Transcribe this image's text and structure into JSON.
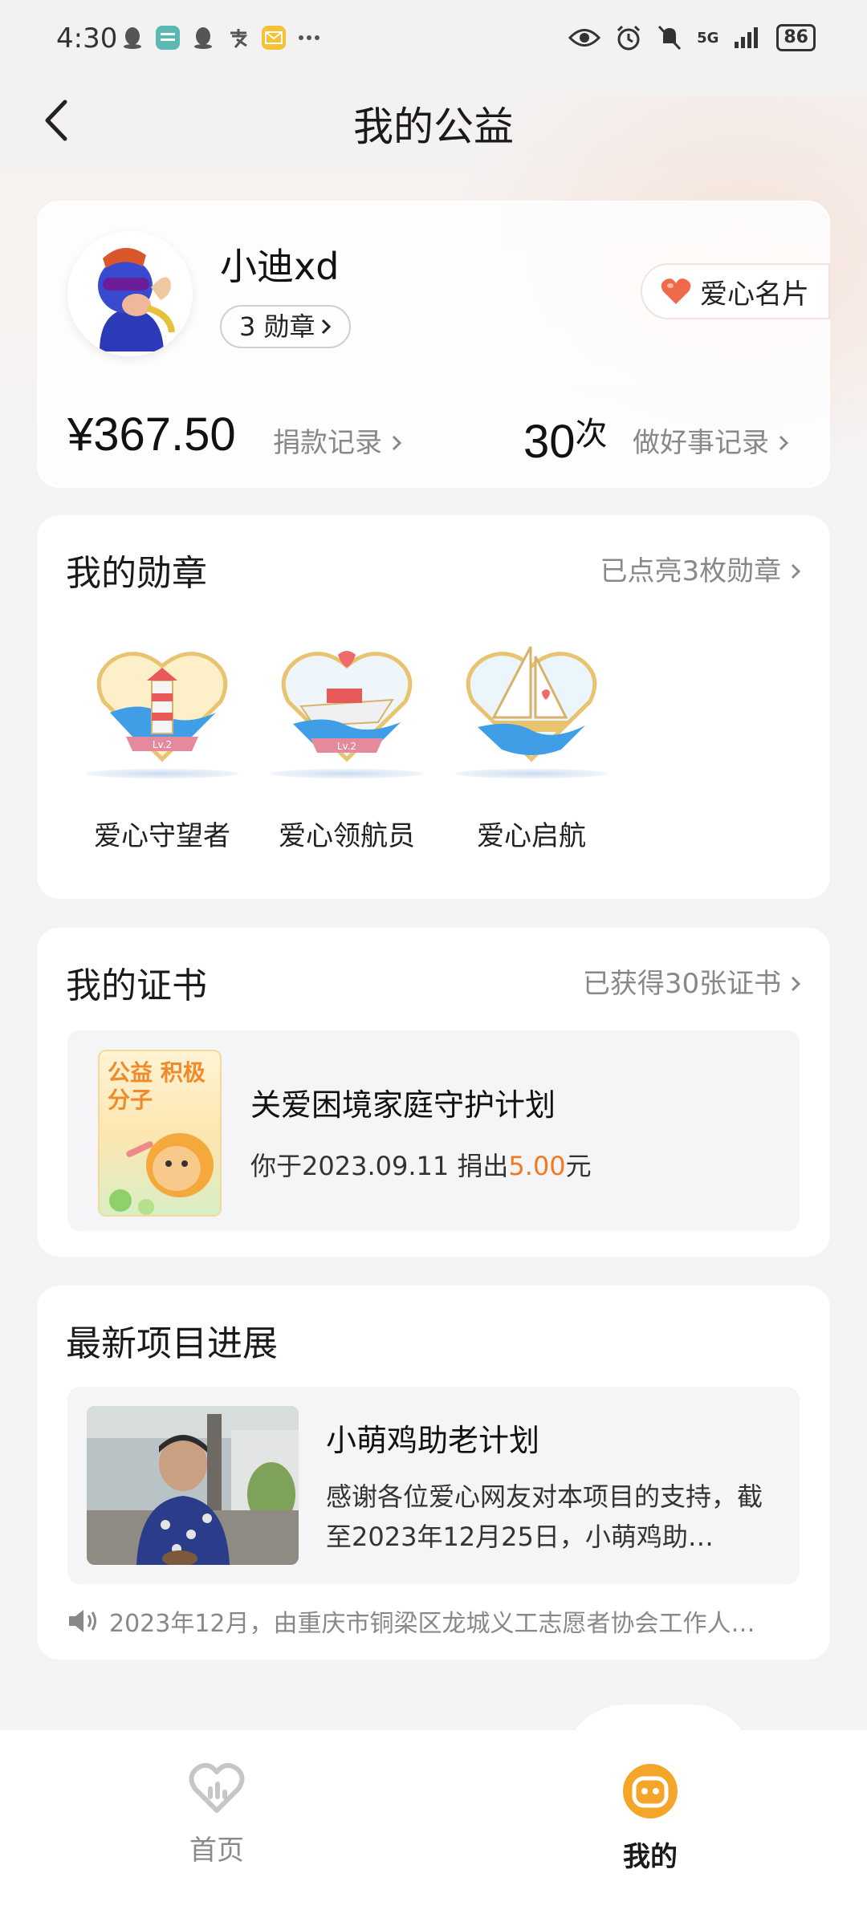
{
  "status_bar": {
    "time": "4:30",
    "left_icons": [
      "qq-icon",
      "boss-app-icon",
      "qq-icon",
      "alipay-icon",
      "mail-icon",
      "more-icon"
    ],
    "battery": "86",
    "network": "5G"
  },
  "header": {
    "title": "我的公益"
  },
  "profile": {
    "username": "小迪xd",
    "badge_count_label": "3 勋章",
    "love_card_label": "爱心名片",
    "amount": "¥367.50",
    "donation_link": "捐款记录",
    "times_value": "30",
    "times_unit": "次",
    "good_deeds_link": "做好事记录"
  },
  "medals": {
    "title": "我的勋章",
    "link": "已点亮3枚勋章",
    "items": [
      {
        "name": "爱心守望者",
        "level": "Lv.2"
      },
      {
        "name": "爱心领航员",
        "level": "Lv.2"
      },
      {
        "name": "爱心启航",
        "level": ""
      }
    ]
  },
  "certificate": {
    "title": "我的证书",
    "link": "已获得30张证书",
    "thumb_text": "公益 积极分子",
    "item_title": "关爱困境家庭守护计划",
    "desc_prefix": "你于2023.09.11 捐出",
    "desc_amount": "5.00",
    "desc_suffix": "元"
  },
  "project": {
    "title": "最新项目进展",
    "item_title": "小萌鸡助老计划",
    "item_desc": "感谢各位爱心网友对本项目的支持，截至2023年12月25日，小萌鸡助…",
    "notice": "2023年12月，由重庆市铜梁区龙城义工志愿者协会工作人…"
  },
  "tabs": [
    {
      "label": "首页",
      "active": false
    },
    {
      "label": "我的",
      "active": true
    }
  ],
  "colors": {
    "accent_orange": "#f07a1f",
    "tab_active": "#f4a52a",
    "muted_text": "#888888"
  }
}
